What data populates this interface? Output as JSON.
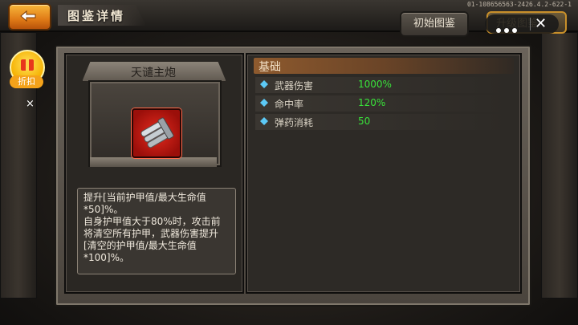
{
  "header": {
    "title": "图鉴详情",
    "build_id": "01-108656563-2426.4.2-622-1",
    "initial_button": "初始图鉴",
    "second_button": "升级图鉴"
  },
  "discount": {
    "label": "折扣",
    "close": "×"
  },
  "weapon": {
    "name": "天谴主炮",
    "description": "提升[当前护甲值/最大生命值*50]%。\n自身护甲值大于80%时，攻击前将清空所有护甲，武器伤害提升[清空的护甲值/最大生命值*100]%。"
  },
  "stats": {
    "section_title": "基础",
    "rows": [
      {
        "label": "武器伤害",
        "value": "1000%"
      },
      {
        "label": "命中率",
        "value": "120%"
      },
      {
        "label": "弹药消耗",
        "value": "50"
      }
    ]
  },
  "colors": {
    "accent": "#f0a020",
    "value_green": "#39e23a"
  }
}
